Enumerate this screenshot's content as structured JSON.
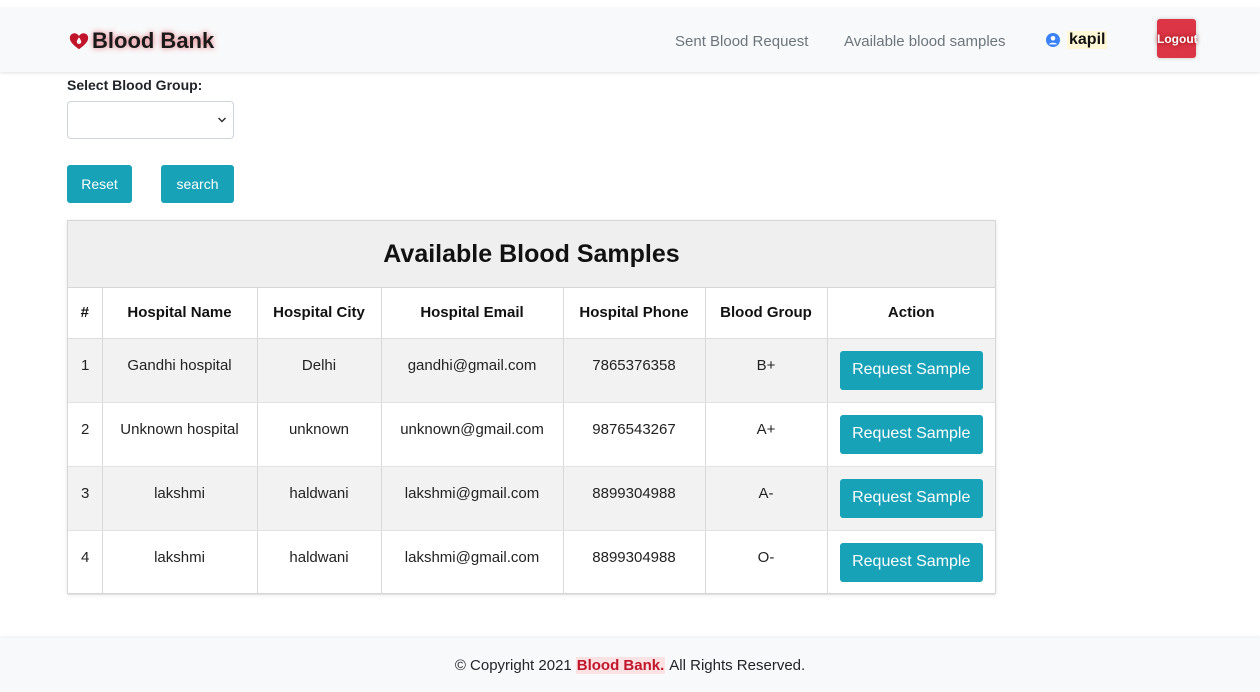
{
  "navbar": {
    "brand": "Blood Bank",
    "links": [
      "Sent Blood Request",
      "Available blood samples"
    ],
    "user": "kapil",
    "logout_label": "Logout"
  },
  "filter": {
    "label": "Select Blood Group:",
    "selected_value": "",
    "reset_label": "Reset",
    "search_label": "search"
  },
  "table": {
    "title": "Available Blood Samples",
    "columns": [
      "#",
      "Hospital Name",
      "Hospital City",
      "Hospital Email",
      "Hospital Phone",
      "Blood Group",
      "Action"
    ],
    "rows": [
      {
        "num": "1",
        "name": "Gandhi hospital",
        "city": "Delhi",
        "email": "gandhi@gmail.com",
        "phone": "7865376358",
        "group": "B+",
        "action": "Request Sample"
      },
      {
        "num": "2",
        "name": "Unknown hospital",
        "city": "unknown",
        "email": "unknown@gmail.com",
        "phone": "9876543267",
        "group": "A+",
        "action": "Request Sample"
      },
      {
        "num": "3",
        "name": "lakshmi",
        "city": "haldwani",
        "email": "lakshmi@gmail.com",
        "phone": "8899304988",
        "group": "A-",
        "action": "Request Sample"
      },
      {
        "num": "4",
        "name": "lakshmi",
        "city": "haldwani",
        "email": "lakshmi@gmail.com",
        "phone": "8899304988",
        "group": "O-",
        "action": "Request Sample"
      }
    ]
  },
  "footer": {
    "prefix": "© Copyright 2021",
    "brand": "Blood Bank.",
    "suffix": "All Rights Reserved."
  },
  "colors": {
    "primary": "#17a2b8",
    "danger": "#dc3545",
    "brand_red": "#c0152b"
  },
  "icons": {
    "brand": "blood-drop-heart-icon",
    "user": "user-circle-icon",
    "select": "chevron-down-icon"
  }
}
